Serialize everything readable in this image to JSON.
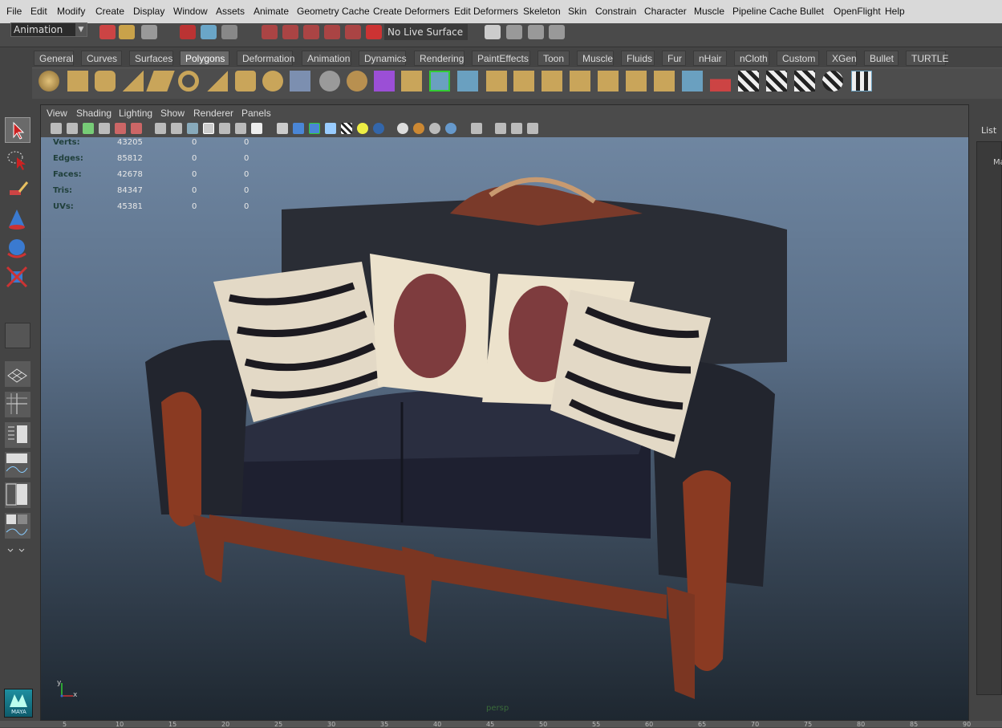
{
  "menubar": [
    "File",
    "Edit",
    "Modify",
    "Create",
    "Display",
    "Window",
    "Assets",
    "Animate",
    "Geometry Cache",
    "Create Deformers",
    "Edit Deformers",
    "Skeleton",
    "Skin",
    "Constrain",
    "Character",
    "Muscle",
    "Pipeline Cache",
    "Bullet",
    "OpenFlight",
    "Help"
  ],
  "toolbar": {
    "mode": "Animation",
    "live_surface": "No Live Surface"
  },
  "shelf_tabs": [
    "General",
    "Curves",
    "Surfaces",
    "Polygons",
    "Deformation",
    "Animation",
    "Dynamics",
    "Rendering",
    "PaintEffects",
    "Toon",
    "Muscle",
    "Fluids",
    "Fur",
    "nHair",
    "nCloth",
    "Custom",
    "XGen",
    "Bullet",
    "TURTLE"
  ],
  "shelf_active": "Polygons",
  "panel_menu": [
    "View",
    "Shading",
    "Lighting",
    "Show",
    "Renderer",
    "Panels"
  ],
  "hud": [
    {
      "label": "Verts:",
      "v1": "43205",
      "v2": "0",
      "v3": "0"
    },
    {
      "label": "Edges:",
      "v1": "85812",
      "v2": "0",
      "v3": "0"
    },
    {
      "label": "Faces:",
      "v1": "42678",
      "v2": "0",
      "v3": "0"
    },
    {
      "label": "Tris:",
      "v1": "84347",
      "v2": "0",
      "v3": "0"
    },
    {
      "label": "UVs:",
      "v1": "45381",
      "v2": "0",
      "v3": "0"
    }
  ],
  "camera_label": "persp",
  "right_panel": {
    "label": "List",
    "partial": "Ma"
  },
  "logo_text": "MAYA",
  "axis": {
    "x": "x",
    "y": "y"
  },
  "timeline_ticks": [
    "5",
    "10",
    "15",
    "20",
    "25",
    "30",
    "35",
    "40",
    "45",
    "50",
    "55",
    "60",
    "65",
    "70",
    "75",
    "80",
    "85",
    "90"
  ],
  "colors": {
    "menubar_bg": "#d9d9d9",
    "ui_bg": "#444444",
    "hud_label": "#1f3f3a",
    "active_tab": "#6a6a6a"
  }
}
